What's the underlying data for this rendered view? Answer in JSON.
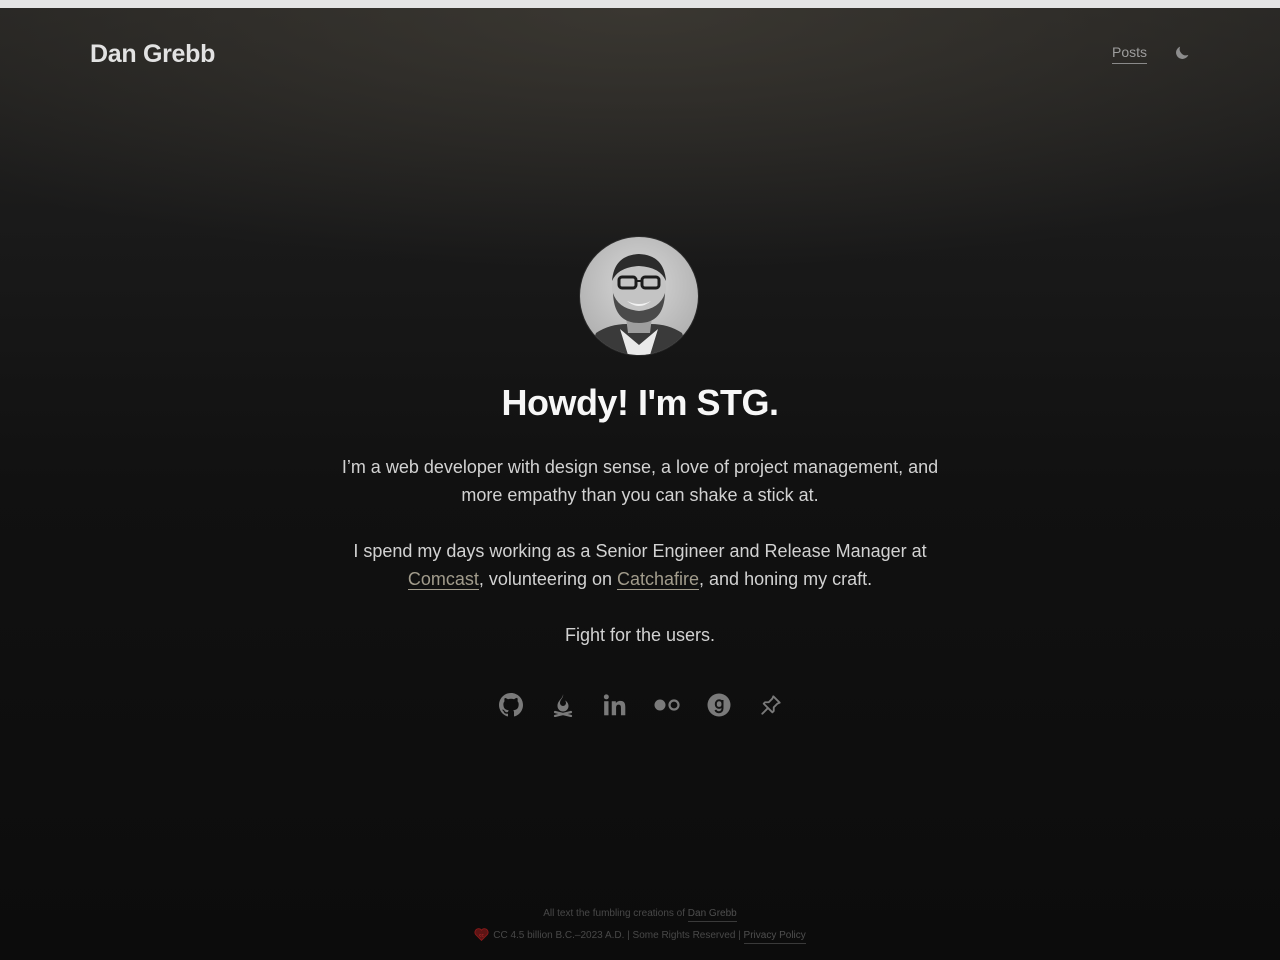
{
  "header": {
    "site_title": "Dan Grebb",
    "nav": {
      "posts_label": "Posts"
    },
    "theme_toggle_icon": "moon-icon"
  },
  "hero": {
    "avatar_icon": "profile-photo",
    "headline": "Howdy! I'm STG.",
    "para1": "I’m a web developer with design sense, a love of project management, and more empathy than you can shake a stick at.",
    "para2": {
      "before": "I spend my days working as a Senior Engineer and Release Manager at ",
      "link1": "Comcast",
      "middle": ", volunteering on ",
      "link2": "Catchafire",
      "after": ", and honing my craft."
    },
    "para3": "Fight for the users."
  },
  "socials": [
    {
      "icon": "github-icon"
    },
    {
      "icon": "campfire-icon"
    },
    {
      "icon": "linkedin-icon"
    },
    {
      "icon": "flickr-icon"
    },
    {
      "icon": "goodreads-icon"
    },
    {
      "icon": "pin-icon"
    }
  ],
  "footer": {
    "line1_prefix": "All text the fumbling creations of ",
    "line1_link": "Dan Grebb",
    "line2_text": "CC 4.5 billion B.C.–2023 A.D. | Some Rights Reserved | ",
    "line2_link": "Privacy Policy",
    "heart_icon": "heart-icon"
  },
  "colors": {
    "background": "#0c0c0c",
    "headline": "#f7f7f7",
    "body_text": "#d2d2d2",
    "link": "#a29c8c",
    "icon": "#7a7a7a",
    "heart": "#8b1a1a"
  }
}
